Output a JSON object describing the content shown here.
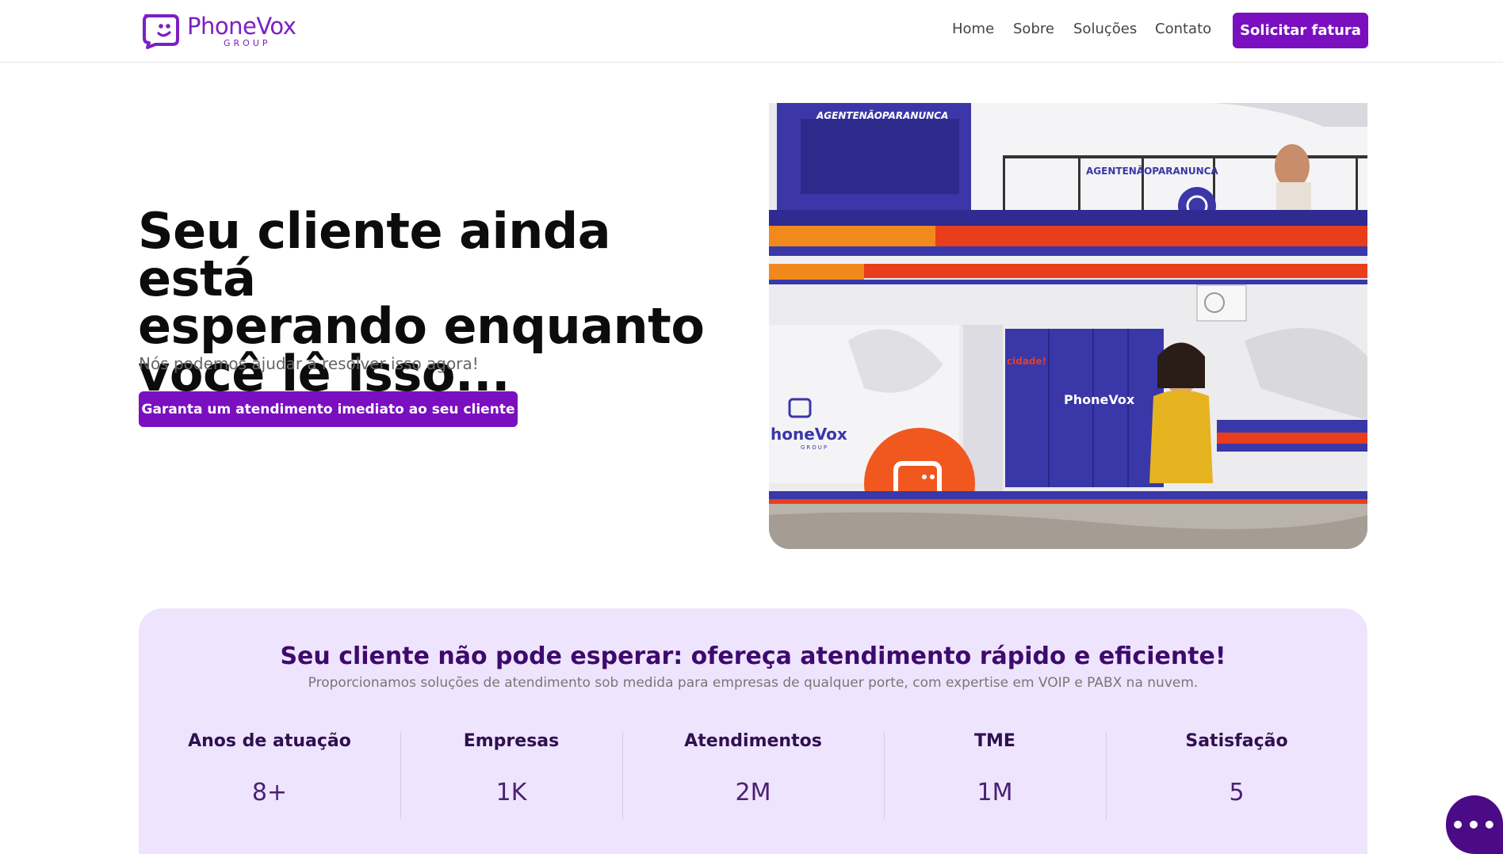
{
  "logo": {
    "name": "PhoneVox",
    "group": "GROUP",
    "icon": "phonevox-smiley-icon",
    "color": "#7d1fc2"
  },
  "nav": {
    "items": [
      "Home",
      "Sobre",
      "Soluções",
      "Contato"
    ],
    "cta": "Solicitar fatura"
  },
  "hero": {
    "title_lines": [
      "Seu cliente ainda está",
      "esperando enquanto",
      "você lê isso..."
    ],
    "subtitle": "Nós podemos ajudar a resolver isso agora!",
    "cta": "Garanta um atendimento imediato ao seu cliente",
    "image": {
      "signs": [
        "AGENTENÃOPARANUNCA",
        "AGENTENÃOPARANUNCA",
        "PhoneVox",
        "honeVox",
        "GROUP",
        "cidade!"
      ]
    }
  },
  "stats": {
    "title": "Seu cliente não pode esperar: ofereça atendimento rápido e eficiente!",
    "subtitle": "Proporcionamos soluções de atendimento sob medida para empresas de qualquer porte, com expertise em VOIP e PABX na nuvem.",
    "items": [
      {
        "label": "Anos de atuação",
        "value": "8+"
      },
      {
        "label": "Empresas",
        "value": "1K"
      },
      {
        "label": "Atendimentos",
        "value": "2M"
      },
      {
        "label": "TME",
        "value": "1M"
      },
      {
        "label": "Satisfação",
        "value": "5"
      }
    ]
  },
  "chat": {
    "icon": "chat-dots-icon",
    "glyph": "•••"
  },
  "colors": {
    "brand": "#7a0fc0",
    "card": "#efe4fd",
    "heading": "#3d0a6e",
    "orange": "#f0581f"
  }
}
